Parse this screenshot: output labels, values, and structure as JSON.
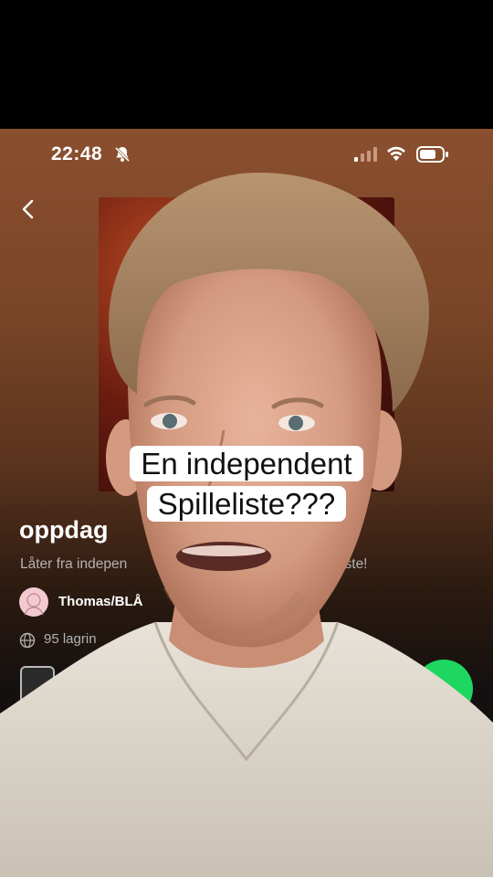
{
  "status_bar": {
    "time": "22:48",
    "icons": [
      "bell-slash-icon",
      "signal-icon",
      "wifi-icon",
      "battery-icon"
    ]
  },
  "nav": {
    "back_icon": "chevron-left-icon"
  },
  "playlist": {
    "title": "oppdag",
    "description_start": "Låter fra indepen",
    "description_end": "eliste!",
    "owner": "Thomas/BLÅ",
    "saves": "95 lagrin",
    "globe_icon": "globe-icon",
    "play_icon": "play-icon",
    "accent_color": "#1ed760"
  },
  "overlay": {
    "caption_line1": "En independent",
    "caption_line2": "Spilleliste???"
  }
}
